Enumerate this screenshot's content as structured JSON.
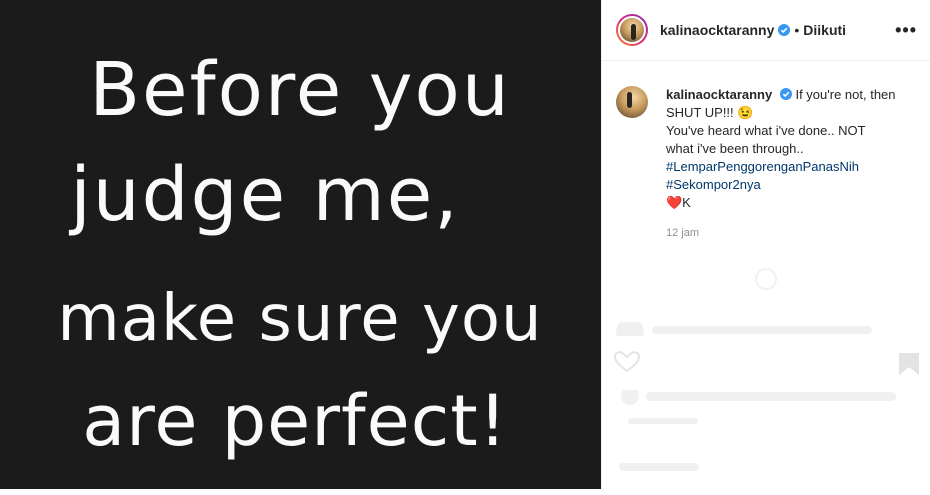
{
  "post": {
    "image": {
      "line1": "Before you",
      "line2": "judge me,",
      "line3": "make sure you",
      "line4": "are perfect!"
    },
    "header": {
      "username": "kalinaocktaranny",
      "separator": "•",
      "follow_status": "Diikuti",
      "more_label": "•••"
    },
    "caption": {
      "username": "kalinaocktaranny",
      "text1": "If you're not, then SHUT UP!!! 😉",
      "text2": "You've heard what i've done.. NOT what i've been through..",
      "hashtag1": "#LemparPenggorenganPanasNih",
      "hashtag2": "#Sekompor2nya",
      "sign": "❤️K",
      "time": "12 jam"
    },
    "colors": {
      "image_bg": "#1b1b1b",
      "text": "#262626",
      "hashtag": "#00376b",
      "muted": "#8e8e8e",
      "verified": "#3897f0"
    },
    "icons": [
      "verified-badge-icon",
      "more-options-icon",
      "heart-icon",
      "comment-icon",
      "share-icon",
      "bookmark-icon"
    ]
  }
}
